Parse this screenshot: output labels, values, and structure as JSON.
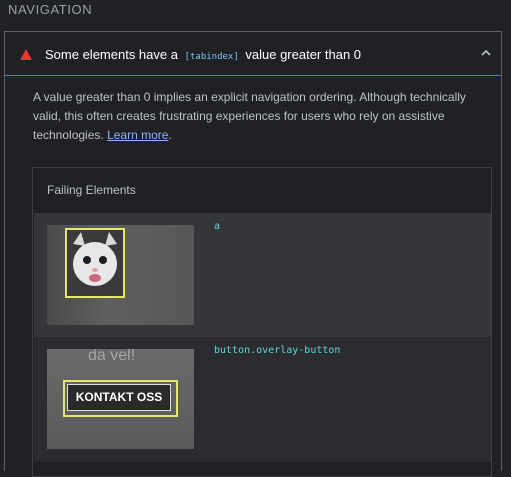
{
  "section": {
    "title": "NAVIGATION"
  },
  "audit": {
    "title_before": "Some elements have a ",
    "title_code": "[tabindex]",
    "title_after": " value greater than 0",
    "description": "A value greater than 0 implies an explicit navigation ordering. Although technically valid, this often creates frustrating experiences for users who rely on assistive technologies. ",
    "learn_more": "Learn more",
    "description_end": ".",
    "failing_title": "Failing Elements",
    "items": [
      {
        "selector": "a"
      },
      {
        "selector": "button.overlay-button",
        "overlay_text": "da vel!",
        "button_label": "KONTAKT OSS"
      }
    ]
  },
  "colors": {
    "background": "#202124",
    "accent_border": "#4f7bd6",
    "warning": "#e8382f",
    "link": "#8ab4f8",
    "selector": "#5fd6d6",
    "highlight": "#e5e76a"
  },
  "icons": {
    "warning": "warning-triangle-icon",
    "collapse": "chevron-up-icon"
  }
}
